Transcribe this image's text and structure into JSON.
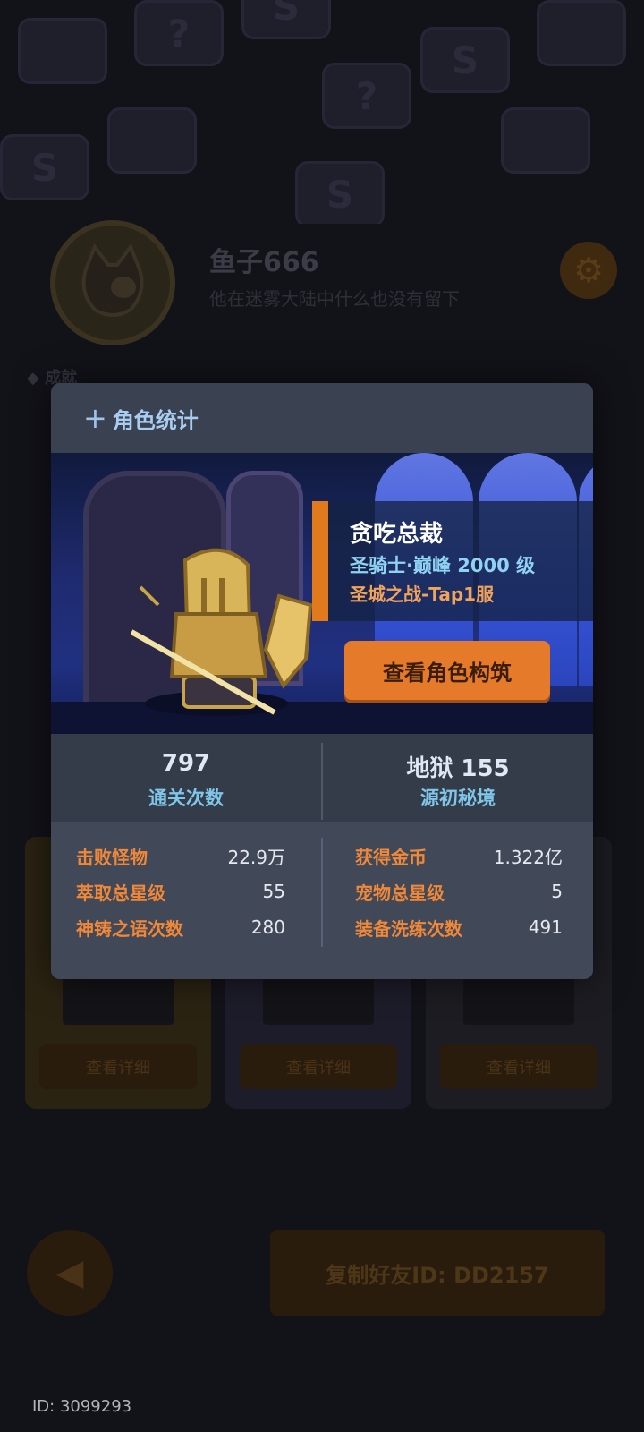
{
  "profile": {
    "name": "鱼子666",
    "bio": "他在迷雾大陆中什么也没有留下"
  },
  "background": {
    "section_label": "成就",
    "card_detail_label": "查看详细",
    "copy_id_label": "复制好友ID: DD2157",
    "player_id": "ID: 3099293"
  },
  "modal": {
    "title": "角色统计",
    "character": {
      "name": "贪吃总裁",
      "class_level": "圣骑士·巅峰 2000 级",
      "server": "圣城之战-Tap1服"
    },
    "view_build_label": "查看角色构筑",
    "summary": [
      {
        "value": "797",
        "label": "通关次数"
      },
      {
        "value": "地狱 155",
        "label": "源初秘境"
      }
    ],
    "stats_left": [
      {
        "label": "击败怪物",
        "value": "22.9万"
      },
      {
        "label": "萃取总星级",
        "value": "55"
      },
      {
        "label": "神铸之语次数",
        "value": "280"
      }
    ],
    "stats_right": [
      {
        "label": "获得金币",
        "value": "1.322亿"
      },
      {
        "label": "宠物总星级",
        "value": "5"
      },
      {
        "label": "装备洗练次数",
        "value": "491"
      }
    ]
  },
  "colors": {
    "accent_orange": "#e47a2a",
    "stat_label": "#f0883a",
    "summary_label": "#7fc6e8",
    "class_text": "#8fd2f2"
  }
}
